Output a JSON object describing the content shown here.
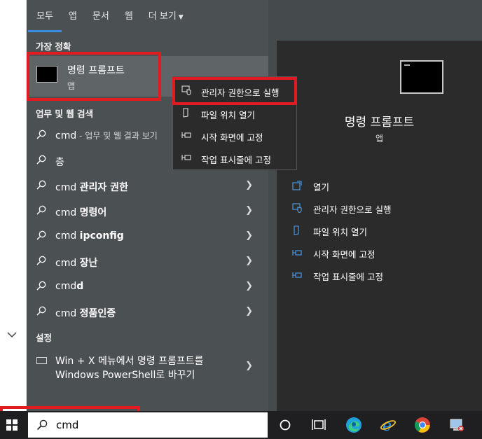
{
  "tabs": [
    {
      "label": "모두"
    },
    {
      "label": "앱"
    },
    {
      "label": "문서"
    },
    {
      "label": "웹"
    },
    {
      "label": "더 보기"
    }
  ],
  "best_match": {
    "section": "가장 정확",
    "title": "명령 프롬프트",
    "subtitle": "앱"
  },
  "web_section": "업무 및 웹 검색",
  "results": [
    {
      "prefix": "cmd",
      "bold": "",
      "hint": " - 업무 및 웹 결과 보기",
      "chevron": false
    },
    {
      "prefix": "",
      "bold": "",
      "plain": "층",
      "hint": "",
      "chevron": false
    },
    {
      "prefix": "cmd ",
      "bold": "관리자 권한",
      "hint": "",
      "chevron": true
    },
    {
      "prefix": "cmd ",
      "bold": "명령어",
      "hint": "",
      "chevron": true
    },
    {
      "prefix": "cmd ",
      "bold": "ipconfig",
      "hint": "",
      "chevron": true
    },
    {
      "prefix": "cmd ",
      "bold": "장난",
      "hint": "",
      "chevron": true
    },
    {
      "prefix": "cmd",
      "bold": "d",
      "hint": "",
      "chevron": true
    },
    {
      "prefix": "cmd ",
      "bold": "정품인증",
      "hint": "",
      "chevron": true
    }
  ],
  "settings_section": "설정",
  "setting_item": {
    "line1": "Win + X 메뉴에서 명령 프롬프트를",
    "line2": "Windows PowerShell로 바꾸기"
  },
  "context_menu": [
    {
      "label": "관리자 권한으로 실행",
      "icon": "shield-icon"
    },
    {
      "label": "파일 위치 열기",
      "icon": "folder-icon"
    },
    {
      "label": "시작 화면에 고정",
      "icon": "pin-icon"
    },
    {
      "label": "작업 표시줄에 고정",
      "icon": "pin-icon"
    }
  ],
  "detail": {
    "title": "명령 프롬프트",
    "subtitle": "앱",
    "actions": [
      {
        "label": "열기",
        "icon": "open-icon"
      },
      {
        "label": "관리자 권한으로 실행",
        "icon": "shield-icon"
      },
      {
        "label": "파일 위치 열기",
        "icon": "folder-icon"
      },
      {
        "label": "시작 화면에 고정",
        "icon": "pin-icon"
      },
      {
        "label": "작업 표시줄에 고정",
        "icon": "pin-icon"
      }
    ]
  },
  "taskbar": {
    "search_value": "cmd"
  },
  "colors": {
    "highlight": "#e21b23",
    "accent": "#3a8fe0"
  }
}
